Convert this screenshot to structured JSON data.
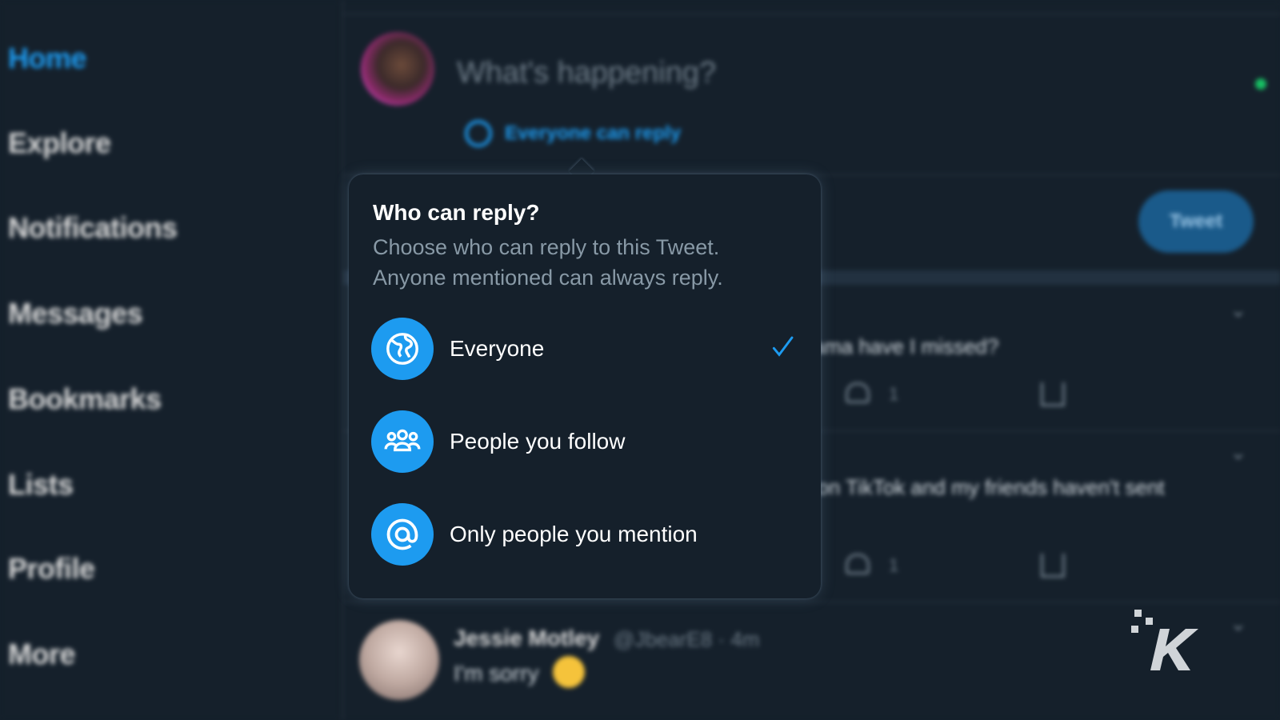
{
  "sidebar": {
    "items": [
      {
        "label": "Home",
        "active": true
      },
      {
        "label": "Explore"
      },
      {
        "label": "Notifications"
      },
      {
        "label": "Messages"
      },
      {
        "label": "Bookmarks"
      },
      {
        "label": "Lists"
      },
      {
        "label": "Profile"
      },
      {
        "label": "More"
      }
    ]
  },
  "composer": {
    "placeholder": "What's happening?",
    "reply_setting": "Everyone can reply",
    "tweet_button": "Tweet"
  },
  "feed": {
    "tweet1_text": "rama have I missed?",
    "tweet1_likes": "1",
    "tweet2_text": "t on TikTok and my friends haven't sent",
    "tweet2_likes": "1",
    "reply_author": "Jessie Motley",
    "reply_handle": "@JbearE8 · 4m",
    "reply_text": "I'm sorry"
  },
  "popup": {
    "title": "Who can reply?",
    "subtitle": "Choose who can reply to this Tweet. Anyone mentioned can always reply.",
    "options": [
      {
        "label": "Everyone",
        "icon": "globe-icon",
        "selected": true
      },
      {
        "label": "People you follow",
        "icon": "people-icon",
        "selected": false
      },
      {
        "label": "Only people you mention",
        "icon": "at-icon",
        "selected": false
      }
    ]
  },
  "colors": {
    "background": "#15202b",
    "accent": "#1d9bf0",
    "secondary_text": "#8899a6"
  }
}
